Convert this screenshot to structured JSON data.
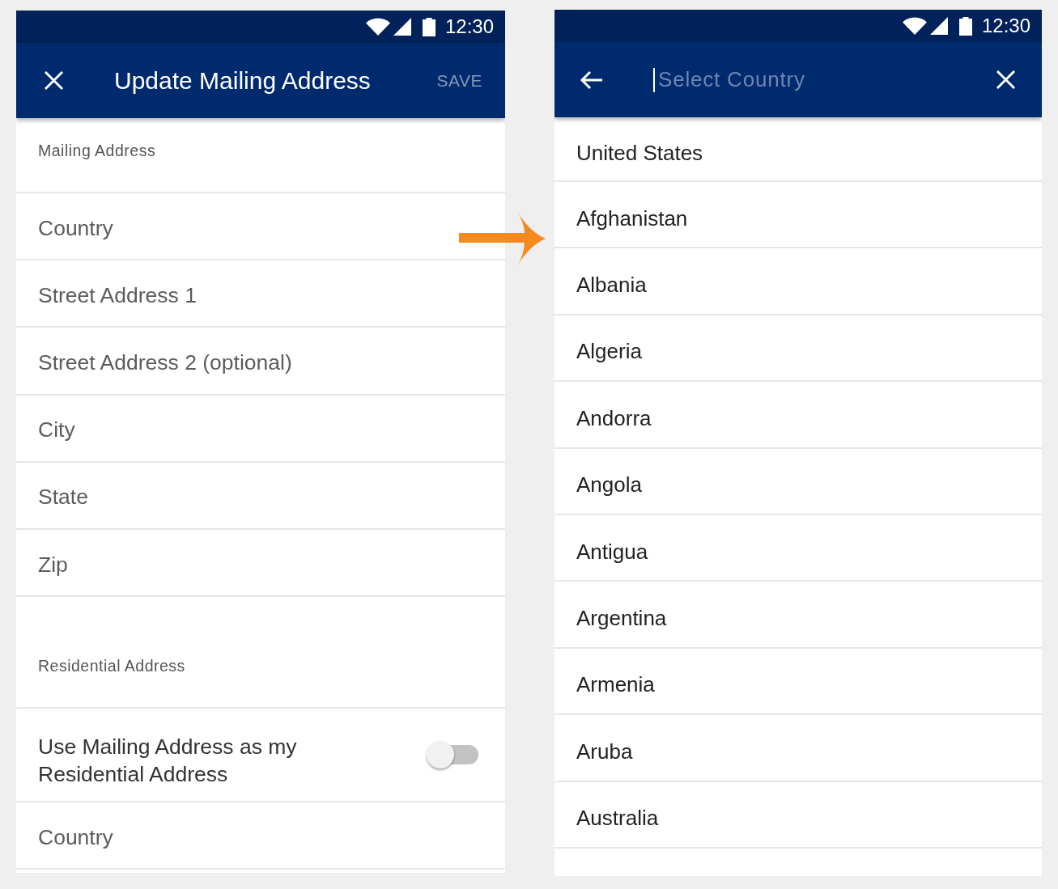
{
  "mailing_screen": {
    "status_bar": {
      "time": "12:30"
    },
    "app_bar": {
      "title": "Update Mailing Address",
      "action": {
        "label": "SAVE",
        "disabled": true
      }
    },
    "sections": [
      {
        "heading": "Mailing Address",
        "rows": [
          {
            "kind": "field",
            "placeholder": "Country"
          },
          {
            "kind": "field",
            "placeholder": "Street Address 1"
          },
          {
            "kind": "field",
            "placeholder": "Street Address 2 (optional)"
          },
          {
            "kind": "field",
            "placeholder": "City"
          },
          {
            "kind": "field",
            "placeholder": "State"
          },
          {
            "kind": "field",
            "placeholder": "Zip"
          }
        ]
      },
      {
        "heading": "Residential Address",
        "rows": [
          {
            "kind": "toggle",
            "label": "Use Mailing Address as my Residential Address",
            "on": false
          },
          {
            "kind": "field",
            "placeholder": "Country"
          }
        ]
      }
    ]
  },
  "country_screen": {
    "status_bar": {
      "time": "12:30"
    },
    "search": {
      "placeholder": "Select Country"
    },
    "countries": [
      "United States",
      "Afghanistan",
      "Albania",
      "Algeria",
      "Andorra",
      "Angola",
      "Antigua",
      "Argentina",
      "Armenia",
      "Aruba",
      "Australia"
    ]
  }
}
